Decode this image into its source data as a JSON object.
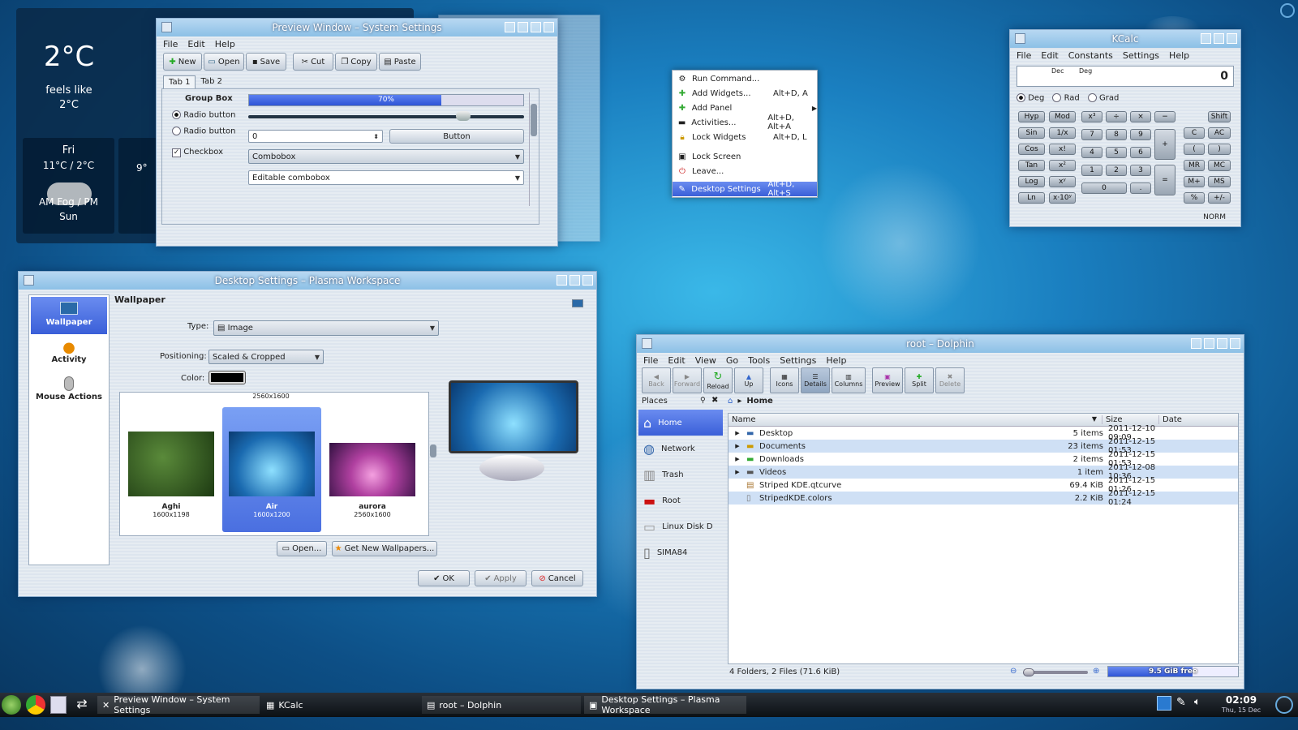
{
  "weather": {
    "temp": "2°C",
    "feels1": "feels like",
    "feels2": "2°C",
    "day": "Fri",
    "range": "11°C / 2°C",
    "cond1": "AM Fog / PM",
    "cond2": "Sun",
    "next_temp": "9°"
  },
  "preview": {
    "title": "Preview Window – System Settings",
    "menu": [
      "File",
      "Edit",
      "Help"
    ],
    "toolbar": [
      "New",
      "Open",
      "Save",
      "Cut",
      "Copy",
      "Paste"
    ],
    "tabs": [
      "Tab 1",
      "Tab 2"
    ],
    "group_box": "Group Box",
    "radio1": "Radio button",
    "radio2": "Radio button",
    "checkbox": "Checkbox",
    "progress_label": "70%",
    "progress": 0.7,
    "slider": 0.78,
    "spin_value": "0",
    "button": "Button",
    "combobox": "Combobox",
    "editable_combo": "Editable combobox"
  },
  "context_menu": {
    "items": [
      {
        "label": "Run Command...",
        "shortcut": ""
      },
      {
        "label": "Add Widgets...",
        "shortcut": "Alt+D, A"
      },
      {
        "label": "Add Panel",
        "shortcut": ""
      },
      {
        "label": "Activities...",
        "shortcut": "Alt+D, Alt+A"
      },
      {
        "label": "Lock Widgets",
        "shortcut": "Alt+D, L"
      },
      {
        "label": "Lock Screen",
        "shortcut": ""
      },
      {
        "label": "Leave...",
        "shortcut": ""
      },
      {
        "label": "Desktop Settings",
        "shortcut": "Alt+D, Alt+S"
      }
    ]
  },
  "kcalc": {
    "title": "KCalc",
    "menu": [
      "File",
      "Edit",
      "Constants",
      "Settings",
      "Help"
    ],
    "dec": "Dec",
    "deg": "Deg",
    "display": "0",
    "angle": [
      "Deg",
      "Rad",
      "Grad"
    ],
    "mode": "NORM",
    "keys": {
      "hyp": "Hyp",
      "mod": "Mod",
      "sin": "Sin",
      "inv": "1/x",
      "cos": "Cos",
      "fact": "x!",
      "tan": "Tan",
      "sq": "x²",
      "log": "Log",
      "pow": "xʸ",
      "ln": "Ln",
      "exp": "x·10ʸ",
      "cube": "x³",
      "div": "÷",
      "mul": "×",
      "minus": "−",
      "shift": "Shift",
      "n7": "7",
      "n8": "8",
      "n9": "9",
      "c": "C",
      "ac": "AC",
      "n4": "4",
      "n5": "5",
      "n6": "6",
      "plus": "+",
      "lp": "(",
      "rp": ")",
      "n1": "1",
      "n2": "2",
      "n3": "3",
      "mr": "MR",
      "mc": "MC",
      "eq": "=",
      "mplus": "M+",
      "ms": "MS",
      "n0": "0",
      "dot": ".",
      "pct": "%",
      "pm": "+/-"
    }
  },
  "desktop_settings": {
    "title": "Desktop Settings – Plasma Workspace",
    "sidebar": [
      "Wallpaper",
      "Activity",
      "Mouse Actions"
    ],
    "heading": "Wallpaper",
    "type_label": "Type:",
    "type_value": "Image",
    "pos_label": "Positioning:",
    "pos_value": "Scaled & Cropped",
    "color_label": "Color:",
    "color_value": "#000000",
    "size_header": "2560x1600",
    "thumbs": [
      {
        "name": "Aghi",
        "size": "1600x1198"
      },
      {
        "name": "Air",
        "size": "1600x1200"
      },
      {
        "name": "aurora",
        "size": "2560x1600"
      }
    ],
    "open": "Open...",
    "get_new": "Get New Wallpapers...",
    "ok": "OK",
    "apply": "Apply",
    "cancel": "Cancel"
  },
  "dolphin": {
    "title": "root – Dolphin",
    "menu": [
      "File",
      "Edit",
      "View",
      "Go",
      "Tools",
      "Settings",
      "Help"
    ],
    "toolbar": [
      "Back",
      "Forward",
      "Reload",
      "Up",
      "Icons",
      "Details",
      "Columns",
      "Preview",
      "Split",
      "Delete"
    ],
    "places_title": "Places",
    "places": [
      "Home",
      "Network",
      "Trash",
      "Root",
      "Linux Disk D",
      "SIMA84"
    ],
    "breadcrumb": "Home",
    "cols": [
      "Name",
      "Size",
      "Date"
    ],
    "files": [
      {
        "name": "Desktop",
        "size": "5 items",
        "date": "2011-12-10 09:09"
      },
      {
        "name": "Documents",
        "size": "23 items",
        "date": "2011-12-15 01:53"
      },
      {
        "name": "Downloads",
        "size": "2 items",
        "date": "2011-12-15 01:53"
      },
      {
        "name": "Videos",
        "size": "1 item",
        "date": "2011-12-08 10:36"
      },
      {
        "name": "Striped KDE.qtcurve",
        "size": "69.4 KiB",
        "date": "2011-12-15 01:26"
      },
      {
        "name": "StripedKDE.colors",
        "size": "2.2 KiB",
        "date": "2011-12-15 01:24"
      }
    ],
    "status": "4 Folders, 2 Files (71.6 KiB)",
    "free": "9.5 GiB free",
    "free_fraction": 0.65
  },
  "taskbar": {
    "tasks": [
      "Preview Window – System Settings",
      "KCalc",
      "root – Dolphin",
      "Desktop Settings – Plasma Workspace"
    ],
    "time": "02:09",
    "date": "Thu, 15 Dec"
  }
}
